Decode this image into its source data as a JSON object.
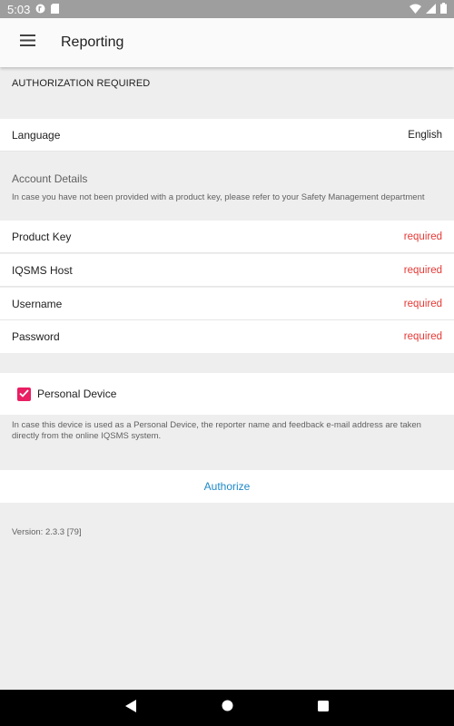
{
  "status_bar": {
    "time": "5:03",
    "icons": [
      "app-notification-icon",
      "sd-card-icon",
      "wifi-icon",
      "signal-icon",
      "battery-icon"
    ]
  },
  "app_bar": {
    "title": "Reporting",
    "menu_icon": "hamburger-menu-icon"
  },
  "auth_header": "AUTHORIZATION REQUIRED",
  "language": {
    "label": "Language",
    "value": "English"
  },
  "account": {
    "title": "Account Details",
    "hint": "In case you have not been provided with a product key, please refer to your Safety Management department",
    "fields": [
      {
        "label": "Product Key",
        "value": "required"
      },
      {
        "label": "IQSMS Host",
        "value": "required"
      },
      {
        "label": "Username",
        "value": "required"
      },
      {
        "label": "Password",
        "value": "required"
      }
    ]
  },
  "personal_device": {
    "label": "Personal Device",
    "checked": true,
    "hint": "In case this device is used as a Personal Device, the reporter name and feedback e-mail address are taken directly from the online IQSMS system."
  },
  "authorize_label": "Authorize",
  "version": "Version: 2.3.3 [79]",
  "colors": {
    "accent": "#e91e63",
    "required": "#e53935",
    "link": "#1e88c8",
    "background": "#eeeeee"
  }
}
